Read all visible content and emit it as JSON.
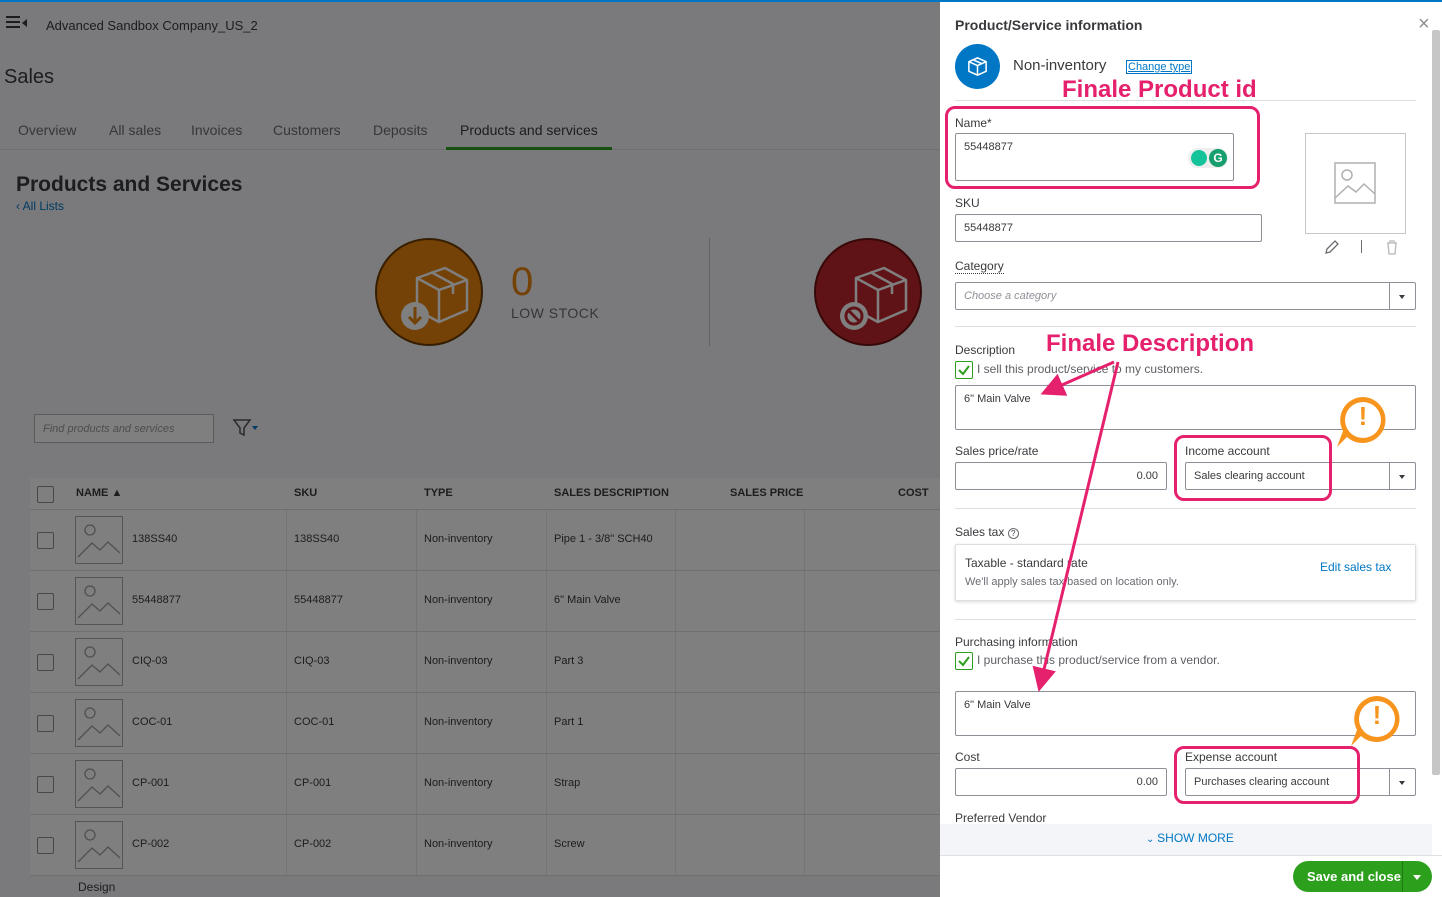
{
  "app": {
    "company_name": "Advanced Sandbox Company_US_2",
    "section_title": "Sales",
    "tabs": [
      {
        "label": "Overview"
      },
      {
        "label": "All sales"
      },
      {
        "label": "Invoices"
      },
      {
        "label": "Customers"
      },
      {
        "label": "Deposits"
      },
      {
        "label": "Products and services"
      }
    ],
    "active_tab": "Products and services",
    "page_title": "Products and Services",
    "all_lists_link": "All Lists",
    "low_stock_count": "0",
    "low_stock_label": "LOW STOCK",
    "search_placeholder": "Find products and services",
    "table": {
      "columns": [
        "NAME",
        "SKU",
        "TYPE",
        "SALES DESCRIPTION",
        "SALES PRICE",
        "COST"
      ],
      "rows": [
        {
          "name": "138SS40",
          "sku": "138SS40",
          "type": "Non-inventory",
          "desc": "Pipe 1 - 3/8\" SCH40"
        },
        {
          "name": "55448877",
          "sku": "55448877",
          "type": "Non-inventory",
          "desc": "6\" Main Valve"
        },
        {
          "name": "CIQ-03",
          "sku": "CIQ-03",
          "type": "Non-inventory",
          "desc": "Part 3"
        },
        {
          "name": "COC-01",
          "sku": "COC-01",
          "type": "Non-inventory",
          "desc": "Part 1"
        },
        {
          "name": "CP-001",
          "sku": "CP-001",
          "type": "Non-inventory",
          "desc": "Strap"
        },
        {
          "name": "CP-002",
          "sku": "CP-002",
          "type": "Non-inventory",
          "desc": "Screw"
        }
      ]
    },
    "footer_text": "Design"
  },
  "panel": {
    "title": "Product/Service information",
    "close_symbol": "×",
    "type_label": "Non-inventory",
    "change_type": "Change type",
    "name_label": "Name*",
    "name_value": "55448877",
    "sku_label": "SKU",
    "sku_value": "55448877",
    "category_label": "Category",
    "category_placeholder": "Choose a category",
    "description_label": "Description",
    "sell_checkbox_label": "I sell this product/service to my customers.",
    "sales_description": "6\" Main Valve",
    "sales_price_label": "Sales price/rate",
    "sales_price_value": "0.00",
    "income_account_label": "Income account",
    "income_account_value": "Sales clearing account",
    "sales_tax_label": "Sales tax",
    "tax_title": "Taxable - standard rate",
    "tax_sub": "We'll apply sales tax based on location only.",
    "edit_sales_tax": "Edit sales tax",
    "purchasing_label": "Purchasing information",
    "purchase_checkbox_label": "I purchase this product/service from a vendor.",
    "purchase_description": "6\" Main Valve",
    "cost_label": "Cost",
    "cost_value": "0.00",
    "expense_account_label": "Expense account",
    "expense_account_value": "Purchases clearing account",
    "preferred_vendor_label": "Preferred Vendor",
    "show_more": "SHOW MORE",
    "save_close": "Save and close"
  },
  "annotations": {
    "product_id": "Finale Product id",
    "description": "Finale Description",
    "warning_symbol": "!"
  },
  "colors": {
    "brand_green": "#2ca01c",
    "link_blue": "#0077c5",
    "annotation_pink": "#e5216e",
    "warning_orange": "#f7941d"
  }
}
